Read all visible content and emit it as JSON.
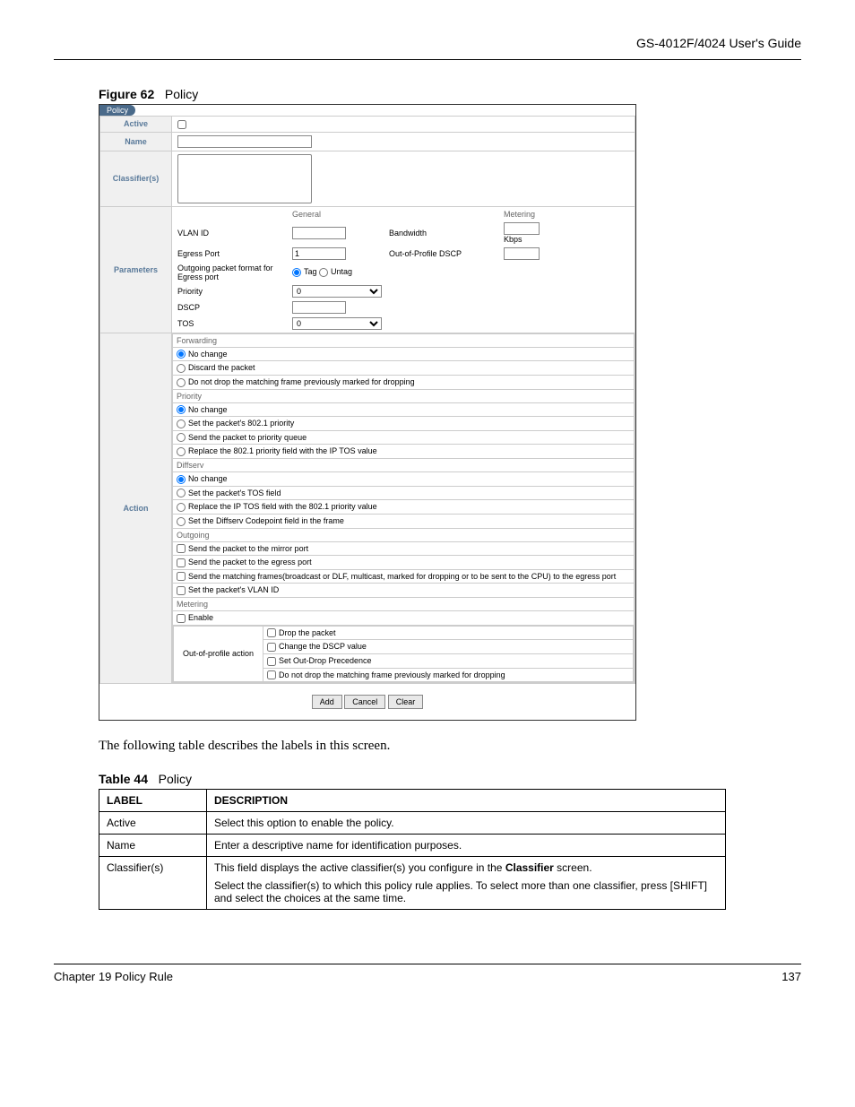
{
  "header": {
    "guide_title": "GS-4012F/4024 User's Guide"
  },
  "figure": {
    "label": "Figure 62",
    "title": "Policy"
  },
  "screenshot": {
    "tab_title": "Policy",
    "rows": {
      "active": "Active",
      "name": "Name",
      "classifiers": "Classifier(s)",
      "parameters": "Parameters",
      "action": "Action"
    },
    "params": {
      "general_hdr": "General",
      "metering_hdr": "Metering",
      "vlan_id": "VLAN ID",
      "bandwidth": "Bandwidth",
      "kbps": "Kbps",
      "egress_port": "Egress Port",
      "egress_port_val": "1",
      "out_profile_dscp": "Out-of-Profile DSCP",
      "outgoing_fmt": "Outgoing packet format for Egress port",
      "tag": "Tag",
      "untag": "Untag",
      "priority": "Priority",
      "priority_val": "0",
      "dscp": "DSCP",
      "tos": "TOS",
      "tos_val": "0"
    },
    "actions": {
      "forwarding_hdr": "Forwarding",
      "fwd_nochange": "No change",
      "fwd_discard": "Discard the packet",
      "fwd_donotdrop": "Do not drop the matching frame previously marked for dropping",
      "priority_hdr": "Priority",
      "pri_nochange": "No change",
      "pri_set8021": "Set the packet's 802.1 priority",
      "pri_sendqueue": "Send the packet to priority queue",
      "pri_replace": "Replace the 802.1 priority field with the IP TOS value",
      "diffserv_hdr": "Diffserv",
      "ds_nochange": "No change",
      "ds_settos": "Set the packet's TOS field",
      "ds_replace": "Replace the IP TOS field with the 802.1 priority value",
      "ds_setcp": "Set the Diffserv Codepoint field in the frame",
      "outgoing_hdr": "Outgoing",
      "out_mirror": "Send the packet to the mirror port",
      "out_egress": "Send the packet to the egress port",
      "out_matching": "Send the matching frames(broadcast or DLF, multicast, marked for dropping or to be sent to the CPU) to the egress port",
      "out_setvlan": "Set the packet's VLAN ID",
      "metering_hdr": "Metering",
      "met_enable": "Enable",
      "oop_label": "Out-of-profile action",
      "oop_drop": "Drop the packet",
      "oop_change": "Change the DSCP value",
      "oop_setprec": "Set Out-Drop Precedence",
      "oop_donotdrop": "Do not drop the matching frame previously marked for dropping"
    },
    "buttons": {
      "add": "Add",
      "cancel": "Cancel",
      "clear": "Clear"
    }
  },
  "paragraph": "The following table describes the labels in this screen.",
  "table": {
    "label": "Table 44",
    "title": "Policy",
    "header_label": "LABEL",
    "header_desc": "DESCRIPTION",
    "rows": [
      {
        "label": "Active",
        "desc_plain": "Select this option to enable the policy."
      },
      {
        "label": "Name",
        "desc_plain": "Enter a descriptive name for identification purposes."
      },
      {
        "label": "Classifier(s)",
        "desc_part1": "This field displays the active classifier(s) you configure in the ",
        "desc_bold": "Classifier",
        "desc_part2": " screen.",
        "desc_para2": "Select the classifier(s) to which this policy rule applies. To select more than one classifier, press [SHIFT] and select the choices at the same time."
      }
    ]
  },
  "footer": {
    "chapter": "Chapter 19 Policy Rule",
    "page": "137"
  }
}
